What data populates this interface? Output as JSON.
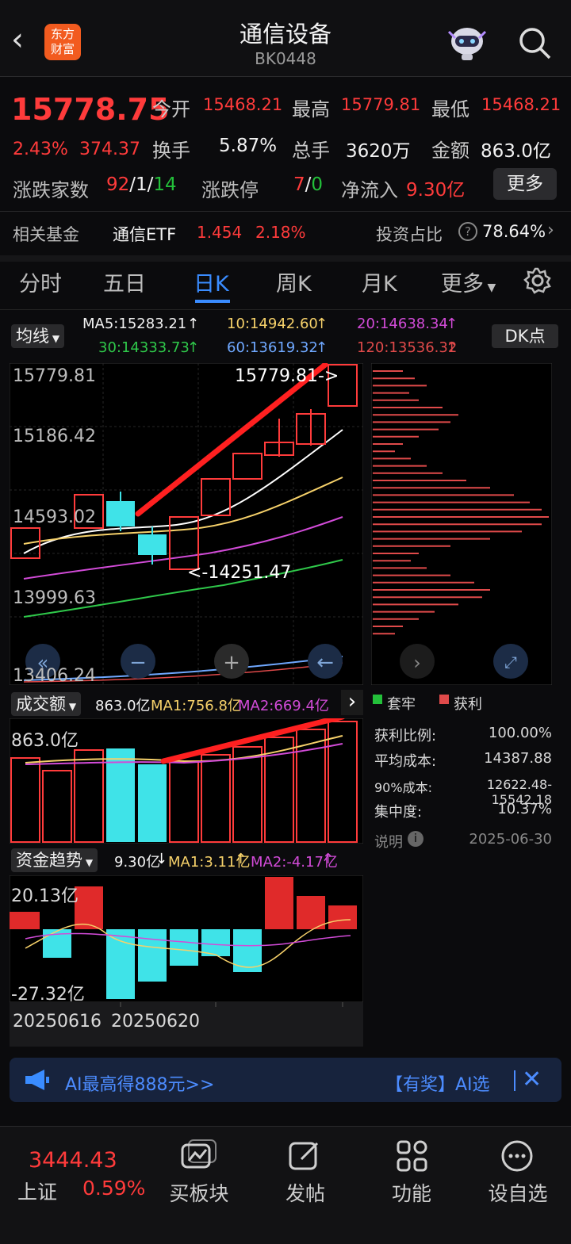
{
  "header": {
    "back_icon": "back-chevron-icon",
    "logo_text": [
      "东方",
      "财富"
    ],
    "title": "通信设备",
    "code": "BK0448"
  },
  "quote": {
    "price": "15778.75",
    "change_pct": "2.43%",
    "change": "374.37",
    "open_label": "今开",
    "open": "15468.21",
    "high_label": "最高",
    "high": "15779.81",
    "low_label": "最低",
    "low": "15468.21",
    "turnover_label": "换手",
    "turnover": "5.87%",
    "volume_label": "总手",
    "volume": "3620万",
    "amount_label": "金额",
    "amount": "863.0亿",
    "updown_label": "涨跌家数",
    "up": "92",
    "flat": "1",
    "down": "14",
    "limit_label": "涨跌停",
    "limit_up": "7",
    "limit_down": "0",
    "inflow_label": "净流入",
    "inflow": "9.30亿",
    "more_button": "更多",
    "fund_label": "相关基金",
    "fund_name": "通信ETF",
    "fund_price": "1.454",
    "fund_change": "2.18%",
    "invest_label": "投资占比",
    "invest_value": "78.64%"
  },
  "tabs": {
    "t1": "分时",
    "t2": "五日",
    "t3": "日K",
    "t4": "周K",
    "t5": "月K",
    "t6": "更多"
  },
  "kline": {
    "ma_select": "均线",
    "dk_button": "DK点",
    "ma5": "MA5:15283.21",
    "ma10": "10:14942.60",
    "ma20": "20:14638.34",
    "ma30": "30:14333.73",
    "ma60": "60:13619.32",
    "ma120": "120:13536.32",
    "y1": "15779.81",
    "y2": "15186.42",
    "y3": "14593.02",
    "y4": "13999.63",
    "y5": "13406.24",
    "high_mark": "15779.81->",
    "low_mark": "<-14251.47",
    "vol_select": "成交额",
    "vol_value": "863.0亿",
    "vol_ma1": "MA1:756.8亿",
    "vol_ma2": "MA2:669.4亿",
    "vol_max": "863.0亿",
    "fund_select": "资金趋势",
    "fund_value": "9.30亿",
    "fund_ma1": "MA1:3.11亿",
    "fund_ma2": "MA2:-4.17亿",
    "fund_top": "20.13亿",
    "fund_bottom": "-27.32亿",
    "date1": "20250616",
    "date2": "20250620"
  },
  "chip": {
    "legend_trapped": "套牢",
    "legend_profit": "获利",
    "ratio_label": "获利比例:",
    "ratio": "100.00%",
    "cost_label": "平均成本:",
    "cost": "14387.88",
    "cost90_label": "90%成本:",
    "cost90": "12622.48-15542.18",
    "conc_label": "集中度:",
    "conc": "10.37%",
    "note_label": "说明",
    "date": "2025-06-30"
  },
  "banner": {
    "left_text": "AI最高得888元>>",
    "right_text": "【有奖】AI选"
  },
  "bottom": {
    "index_value": "3444.43",
    "index_name": "上证",
    "index_change": "0.59%",
    "nav2": "买板块",
    "nav3": "发帖",
    "nav4": "功能",
    "nav5": "设自选"
  },
  "colors": {
    "up": "#ff3b3b",
    "down": "#23c03a",
    "accent": "#3a8cff",
    "bear_candle": "#3fe3e8"
  }
}
